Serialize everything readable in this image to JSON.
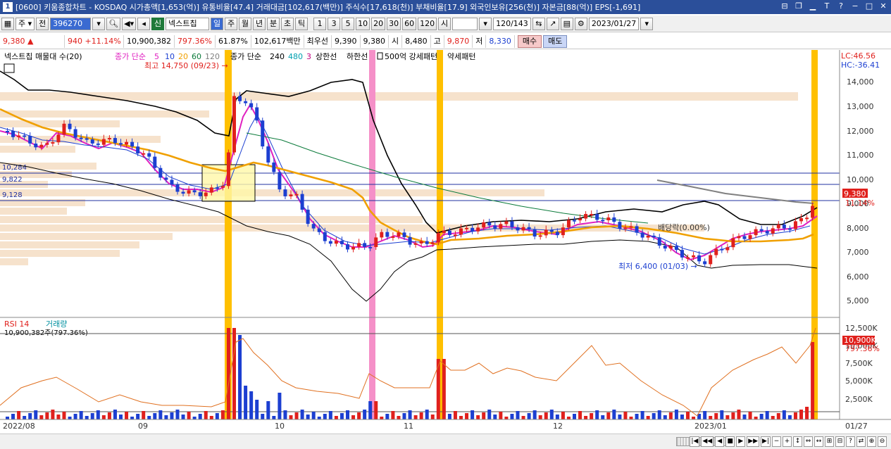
{
  "window": {
    "title": "[0600] 키움종합차트 - KOSDAQ 시가총액[1,653(억)] 유통비율[47.4] 거래대금[102,617(백만)] 주식수[17,618(천)] 부채비율[17.9] 외국인보유[256(천)] 자본금[88(억)] EPS[-1,691]",
    "icon_label": "1"
  },
  "toolbar": {
    "period_select": "주",
    "jeon_label": "전",
    "stock_code": "396270",
    "stock_badge": "신",
    "stock_name": "넥스트칩",
    "period_buttons": [
      "일",
      "주",
      "월",
      "년",
      "분",
      "초",
      "틱"
    ],
    "interval_buttons": [
      "1",
      "3",
      "5",
      "10",
      "20",
      "30",
      "60",
      "120"
    ],
    "si_label": "시",
    "count_display": "120/143",
    "date_value": "2023/01/27"
  },
  "price_info": {
    "current": "9,380",
    "arrow": "▲",
    "change": "940",
    "change_pct": "+11.14%",
    "volume": "10,900,382",
    "volume_ratio": "797.36%",
    "turnover_pct": "61.87%",
    "amount": "102,617백만",
    "priority_label": "최우선",
    "priority_value": "9,390",
    "ask_value": "9,380",
    "open_label": "시",
    "open_value": "8,480",
    "high_label": "고",
    "high_value": "9,870",
    "low_label": "저",
    "low_value": "8,330",
    "buy_label": "매수",
    "sell_label": "매도"
  },
  "chart": {
    "legend_vp": "넥스트칩 매물대 수(20)",
    "legend_ma": [
      "종가 단순",
      "5",
      "10",
      "20",
      "60",
      "120"
    ],
    "legend_ma2": [
      "종가 단순",
      "240",
      "480",
      "3",
      "상한선",
      "하한선"
    ],
    "legend_extra": [
      "500억 강세패턴",
      "약세패턴"
    ],
    "high_annotation": "최고 14,750 (09/23) →",
    "low_annotation": "최저 6,400 (01/03) →",
    "dividend_annotation": "배당락(0.00%)",
    "level_labels": [
      "10,284",
      "9,822",
      "9,128"
    ],
    "price_axis": [
      "14,000",
      "13,000",
      "12,000",
      "11,000",
      "10,000",
      "9,000",
      "8,000",
      "7,000",
      "6,000",
      "5,000"
    ],
    "lc_label": "LC:46.56",
    "hc_label": "HC:-36.41",
    "current_price_tag": "9,380",
    "current_pct_tag": "11.14%",
    "volume_legend": [
      "RSI 14",
      "거래량"
    ],
    "volume_value": "10,900,382주(797.36%)",
    "volume_axis": [
      "12,500K",
      "10,000K",
      "7,500K",
      "5,000K",
      "2,500K"
    ],
    "volume_tag": "10,900K",
    "volume_pct_tag": "797.36%",
    "date_axis": [
      "2022/08",
      "09",
      "10",
      "11",
      "12",
      "2023/01",
      "01/27"
    ],
    "colors": {
      "up": "#e0201c",
      "down": "#1c3fd1",
      "ma5": "#e020c0",
      "ma20": "#f0a000",
      "signal": "#ffc000",
      "signal_pink": "#f590c8",
      "volume_profile": "#f6e2cc"
    }
  },
  "bottom": {
    "controls": [
      "|◀",
      "◀◀",
      "◀",
      "■",
      "▶",
      "▶▶",
      "▶|",
      "−",
      "+",
      "↕",
      "⇔",
      "↔",
      "⊞",
      "⊟",
      "?",
      "⇄",
      "⊕",
      "⊖"
    ]
  }
}
